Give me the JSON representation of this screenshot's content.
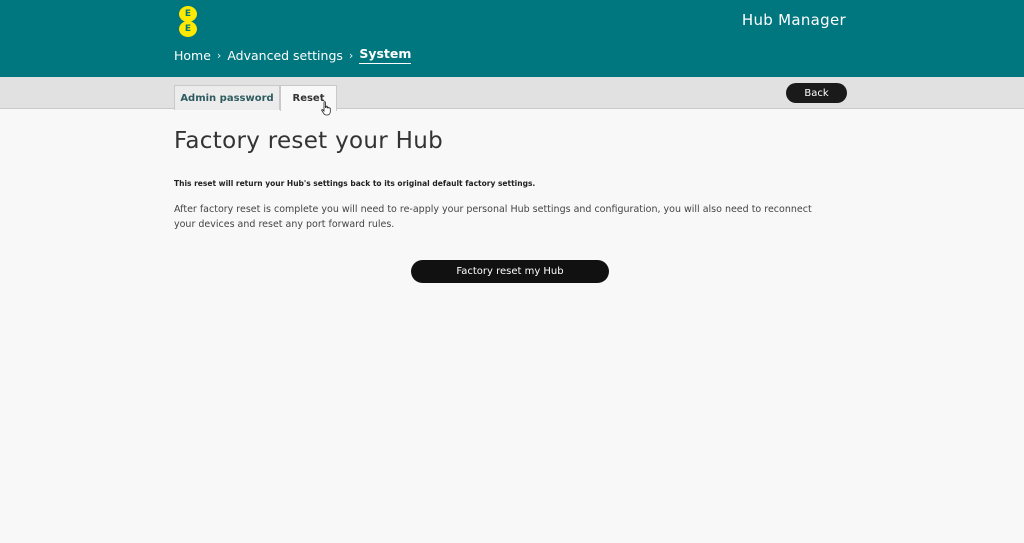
{
  "header": {
    "logo_letters": [
      "E",
      "E"
    ],
    "app_title": "Hub Manager",
    "brand_color": "#00767f",
    "logo_color": "#ffe900"
  },
  "breadcrumb": {
    "items": [
      "Home",
      "Advanced settings"
    ],
    "separator": "›",
    "current": "System"
  },
  "tabs": [
    {
      "label": "Admin password",
      "active": false
    },
    {
      "label": "Reset",
      "active": true
    }
  ],
  "toolbar": {
    "back_label": "Back"
  },
  "main": {
    "title": "Factory reset your Hub",
    "lead": "This reset will return your Hub's settings back to its original default factory settings.",
    "body": "After factory reset is complete you will need to re-apply your personal Hub settings and configuration, you will also need to reconnect your devices and reset any port forward rules.",
    "action_label": "Factory reset my Hub"
  },
  "icons": {
    "cursor": "hand-pointer-icon",
    "breadcrumb_separator": "chevron-right-icon"
  }
}
